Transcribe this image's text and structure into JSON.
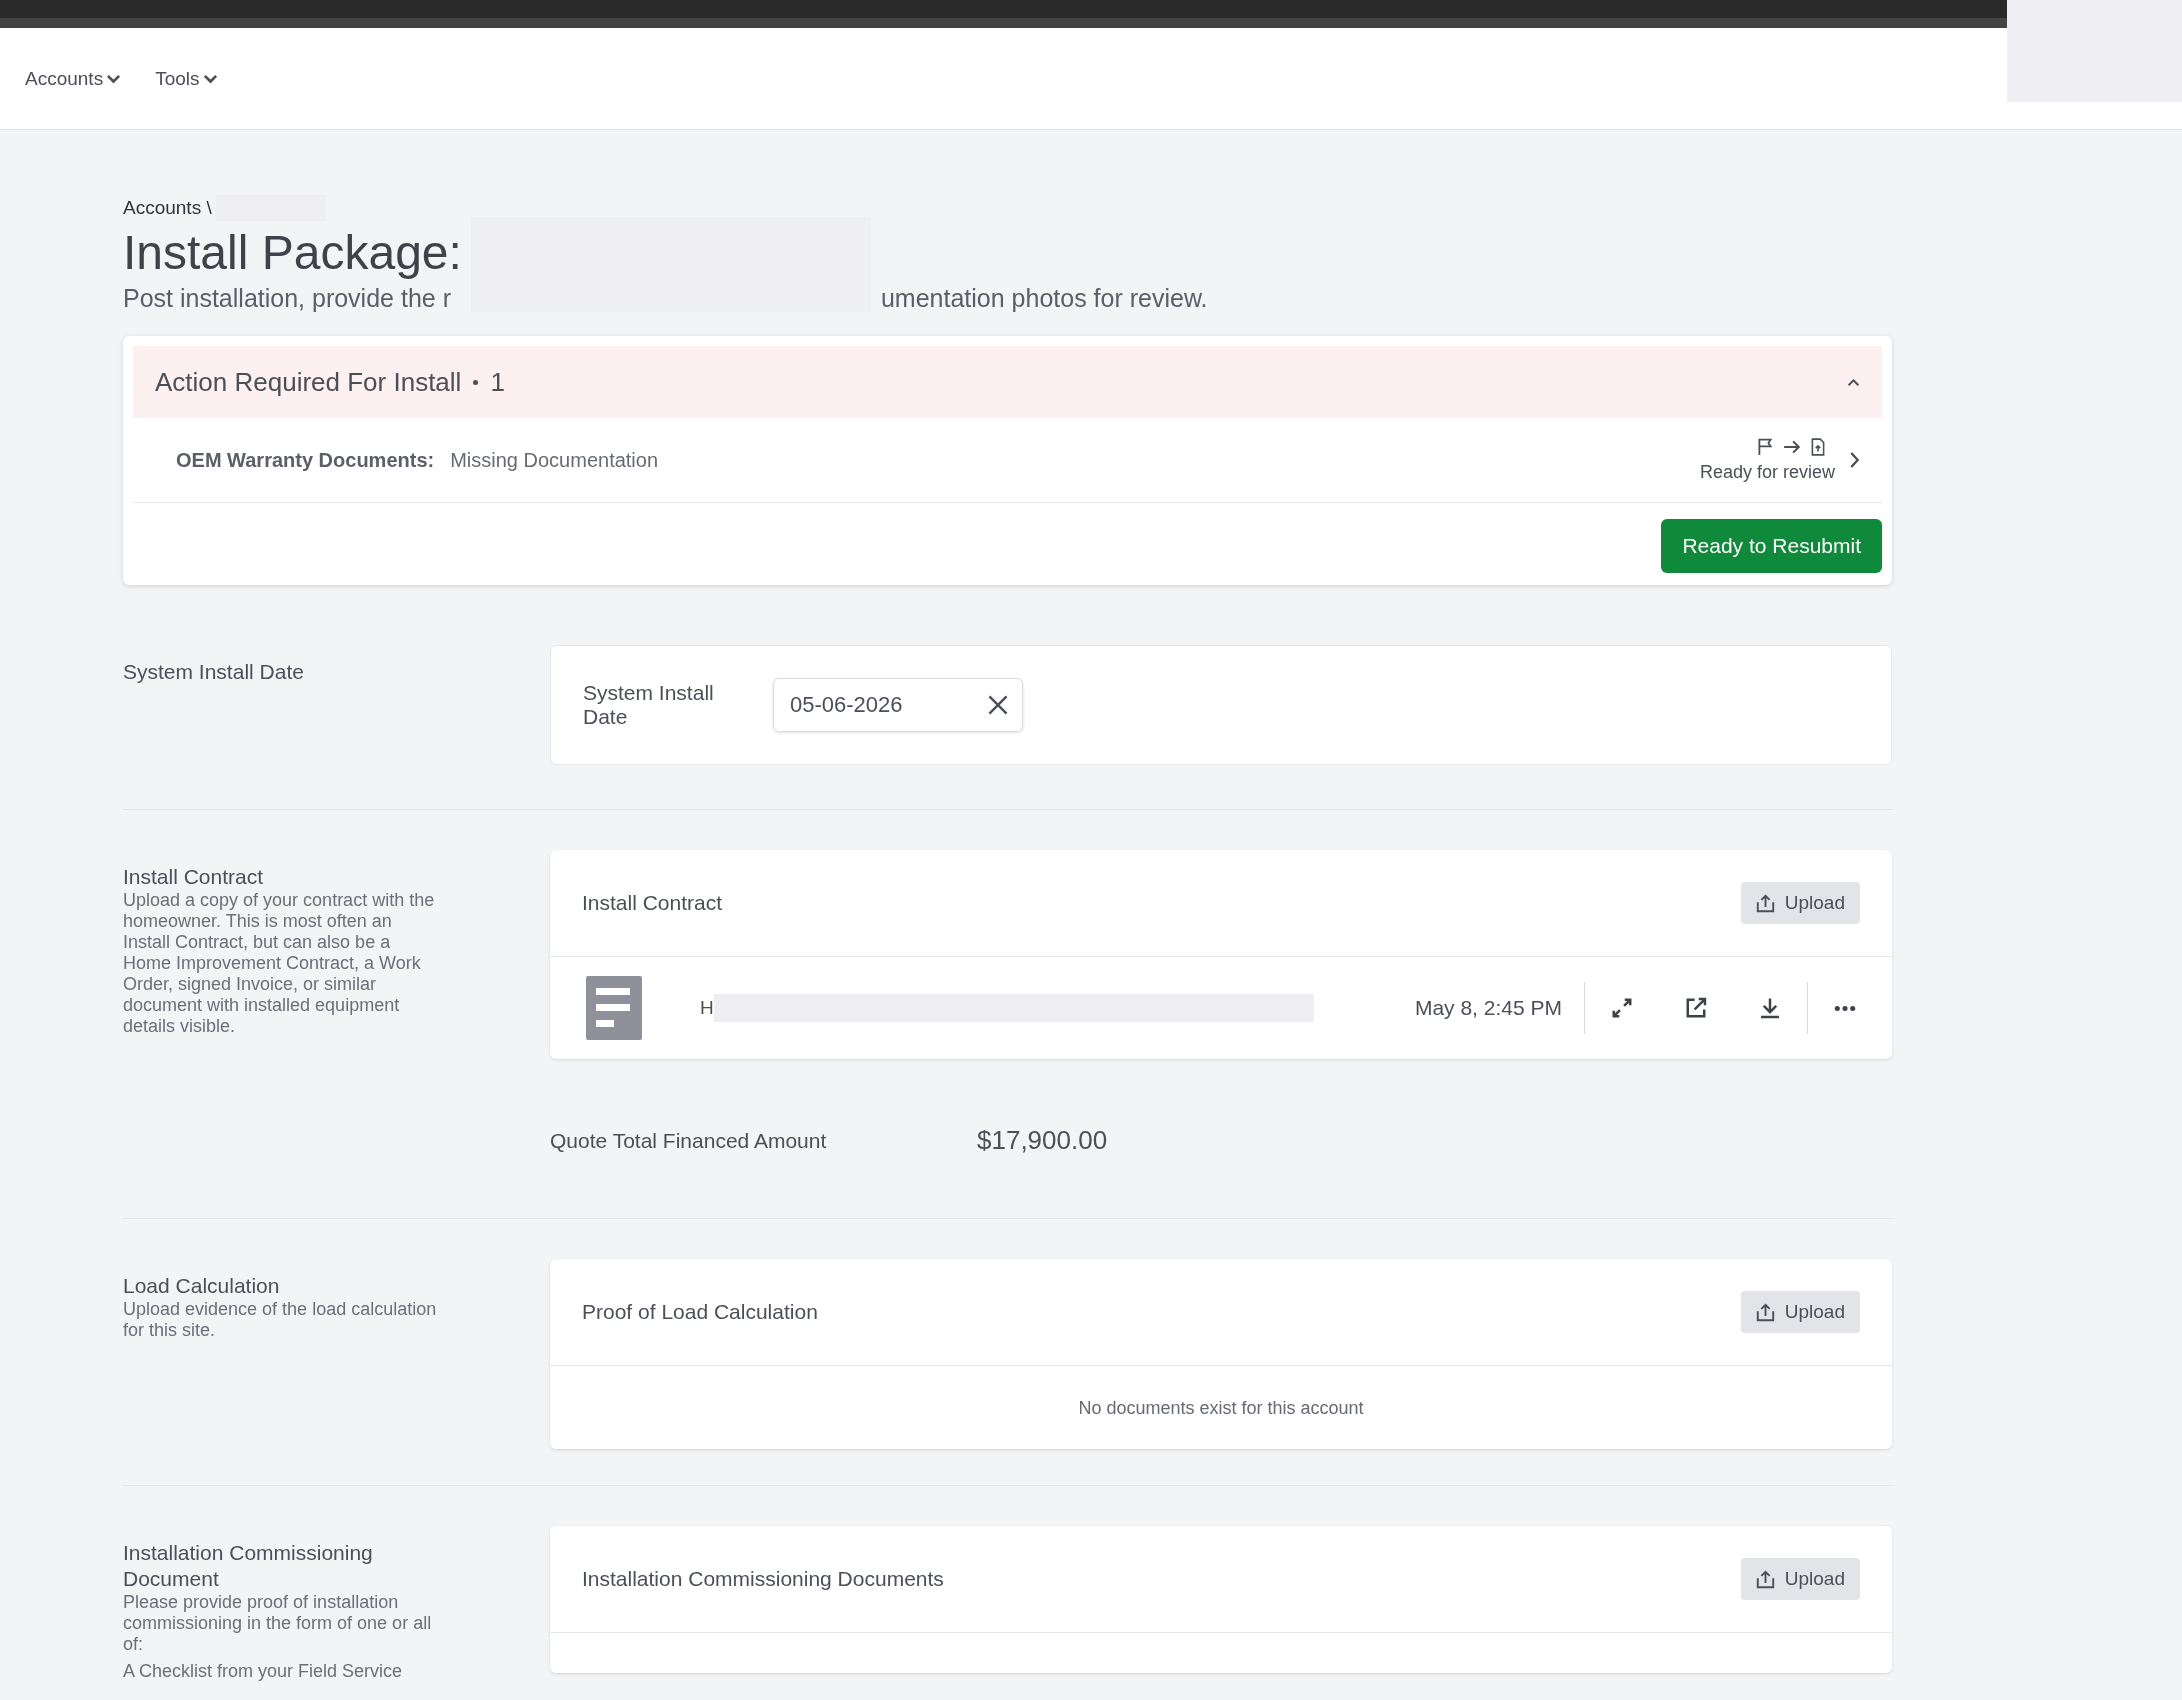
{
  "nav": {
    "menus": [
      {
        "label": "Accounts"
      },
      {
        "label": "Tools"
      }
    ]
  },
  "breadcrumb": "Accounts \\",
  "title": "Install Package:",
  "description": {
    "before": "Post installation, provide the r",
    "after": "umentation photos for review."
  },
  "action_panel": {
    "title": "Action Required For Install",
    "count": "1",
    "expanded": true,
    "items": [
      {
        "label": "OEM Warranty Documents:",
        "value": "Missing Documentation",
        "status": "Ready for review"
      }
    ],
    "button": "Ready to Resubmit"
  },
  "install_date": {
    "section": "System Install Date",
    "label": "System Install Date",
    "value": "05-06-2026"
  },
  "sections": [
    {
      "title": "Install Contract",
      "description": "Upload a copy of your contract with the homeowner. This is most often an Install Contract, but can also be a Home Improvement Contract, a Work Order, signed Invoice, or similar document with installed equipment details visible.",
      "card_title": "Install Contract",
      "upload": "Upload",
      "files": [
        {
          "name": "H",
          "date": "May 8, 2:45 PM"
        }
      ],
      "quote": {
        "label": "Quote Total Financed Amount",
        "value": "$17,900.00"
      }
    },
    {
      "title": "Load Calculation",
      "description": "Upload evidence of the load calculation for this site.",
      "card_title": "Proof of Load Calculation",
      "upload": "Upload",
      "empty": "No documents exist for this account"
    },
    {
      "title": "Installation Commissioning Document",
      "description": "Please provide proof of installation commissioning in the form of one or all of:",
      "extra": "A Checklist from your Field Service",
      "card_title": "Installation Commissioning Documents",
      "upload": "Upload"
    }
  ]
}
